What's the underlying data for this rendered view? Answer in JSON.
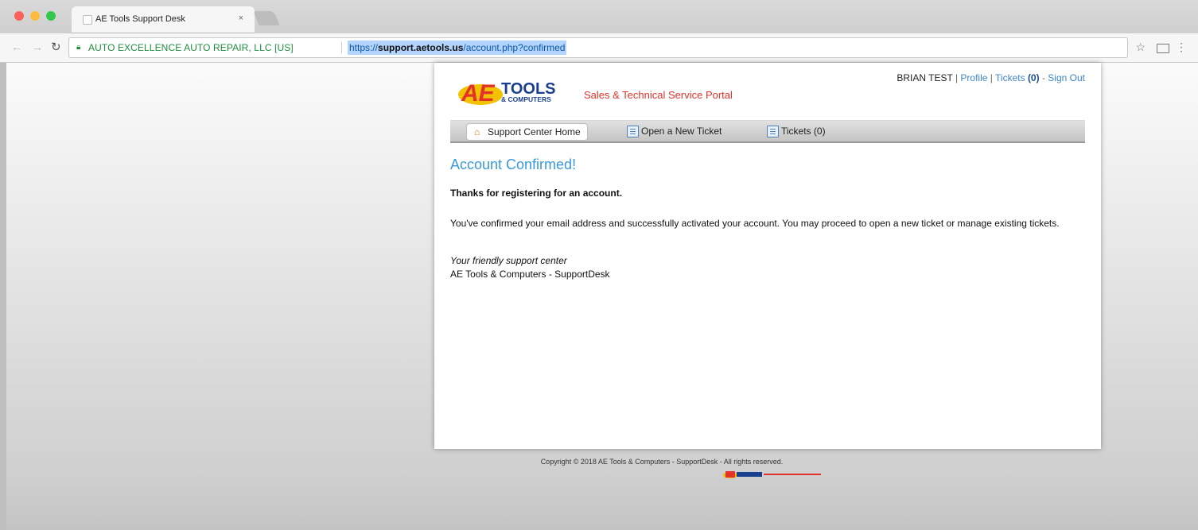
{
  "browser": {
    "tab_title": "AE Tools Support Desk",
    "tab_close": "×",
    "cert_label": "AUTO EXCELLENCE AUTO REPAIR, LLC [US]",
    "url_scheme": "https://",
    "url_host": "support.aetools.us",
    "url_path": "/account.php?confirmed"
  },
  "logo": {
    "text_main": "TOOLS",
    "text_sub": "& COMPUTERS",
    "tagline": "Sales & Technical Service Portal"
  },
  "user_nav": {
    "user_name": "BRIAN TEST",
    "profile_link": "Profile",
    "tickets_link": "Tickets",
    "tickets_count": "(0)",
    "sign_out_link": "Sign Out"
  },
  "nav": {
    "home_label": "Support Center Home",
    "new_ticket_label": "Open a New Ticket",
    "tickets_label": "Tickets (0)"
  },
  "content": {
    "heading": "Account Confirmed!",
    "thanks": "Thanks for registering for an account.",
    "body": "You've confirmed your email address and successfully activated your account. You may proceed to open a new ticket or manage existing tickets.",
    "signature_italic": "Your friendly support center",
    "signature_name": "AE Tools & Computers - SupportDesk"
  },
  "footer": {
    "copyright": "Copyright © 2018 AE Tools & Computers - SupportDesk - All rights reserved."
  },
  "colors": {
    "accent_blue": "#3a9ad9",
    "link_blue": "#3d86c6",
    "brand_red": "#e2322b",
    "brand_yellow": "#f2c200"
  }
}
